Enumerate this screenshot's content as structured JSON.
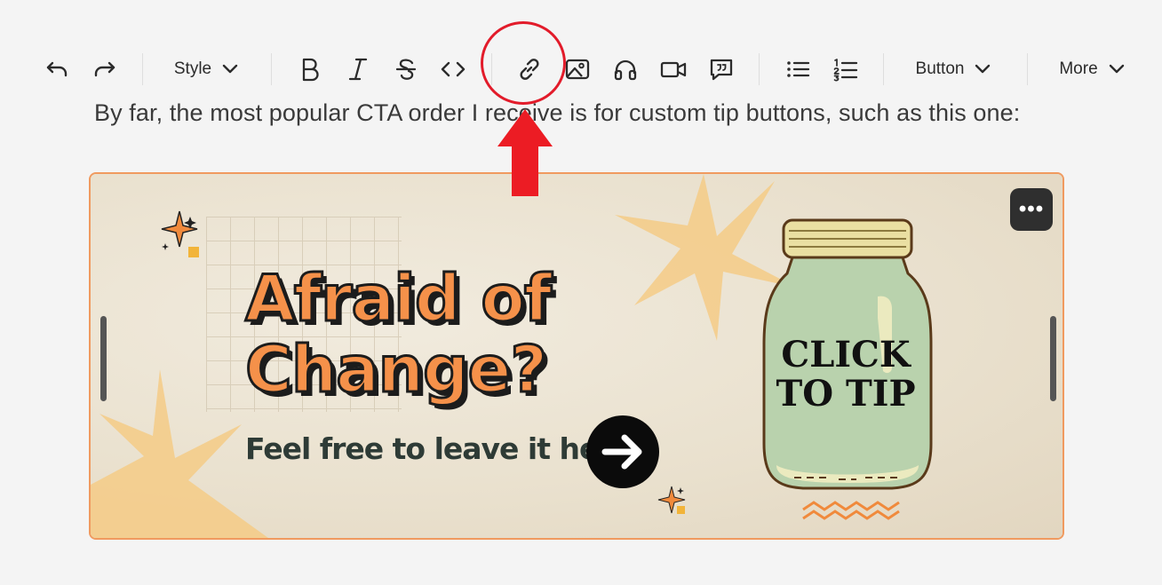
{
  "toolbar": {
    "style_label": "Style",
    "button_label": "Button",
    "more_label": "More",
    "icons": [
      "undo-icon",
      "redo-icon",
      "bold-icon",
      "italic-icon",
      "strikethrough-icon",
      "code-icon",
      "link-icon",
      "image-icon",
      "audio-icon",
      "video-icon",
      "quote-icon",
      "bullet-list-icon",
      "numbered-list-icon",
      "chevron-down-icon"
    ]
  },
  "editor": {
    "paragraph": "By far, the most popular CTA order I receive is for custom tip buttons, such as this one:"
  },
  "banner": {
    "headline_line1": "Afraid of",
    "headline_line2": "Change?",
    "subline": "Feel free to leave it here",
    "jar_line1": "CLICK",
    "jar_line2": "TO TIP",
    "options_label": "•••"
  },
  "colors": {
    "accent_orange": "#f5914a",
    "annotation_red": "#e21b2a",
    "selection_border": "#f09a5f"
  }
}
